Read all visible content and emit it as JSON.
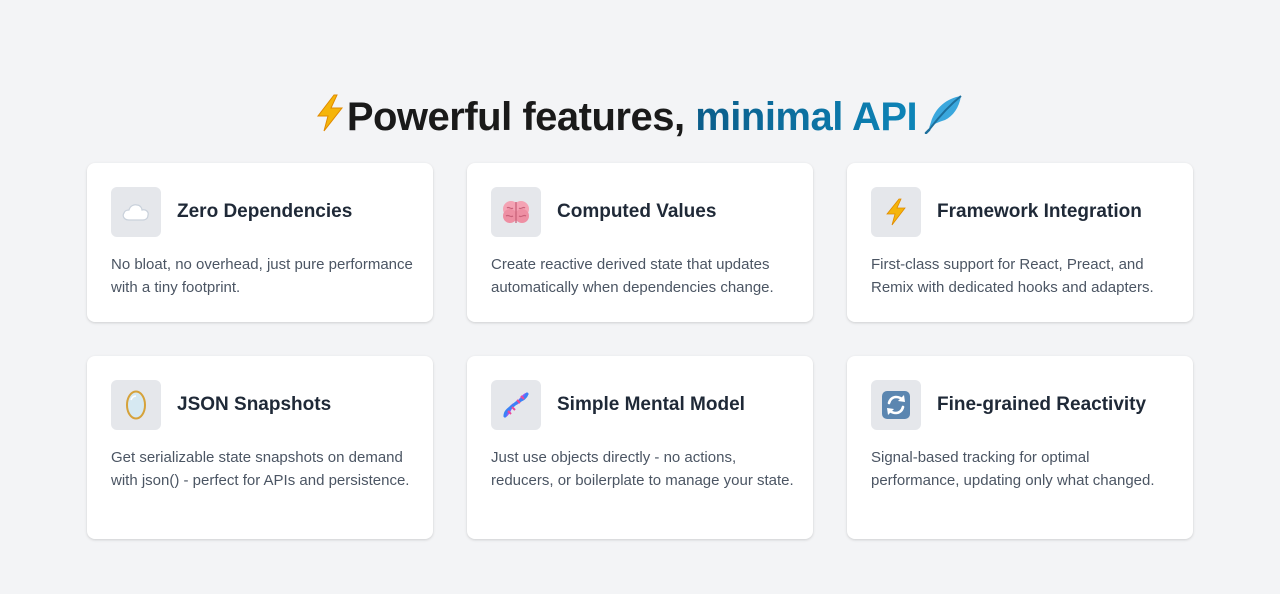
{
  "hero": {
    "title_plain": "Powerful features,",
    "title_accent": "minimal API",
    "leading_icon": "lightning-bolt",
    "trailing_icon": "feather",
    "accent_color": "#0b6f9f"
  },
  "features": [
    {
      "icon": "cloud",
      "title": "Zero Dependencies",
      "description": "No bloat, no overhead, just pure performance with a tiny footprint."
    },
    {
      "icon": "brain",
      "title": "Computed Values",
      "description": "Create reactive derived state that updates automatically when dependencies change."
    },
    {
      "icon": "lightning-bolt",
      "title": "Framework Integration",
      "description": "First-class support for React, Preact, and Remix with dedicated hooks and adapters."
    },
    {
      "icon": "mirror",
      "title": "JSON Snapshots",
      "description": "Get serializable state snapshots on demand with json() - perfect for APIs and persistence."
    },
    {
      "icon": "dna",
      "title": "Simple Mental Model",
      "description": "Just use objects directly - no actions, reducers, or boilerplate to manage your state."
    },
    {
      "icon": "refresh-arrows",
      "title": "Fine-grained Reactivity",
      "description": "Signal-based tracking for optimal performance, updating only what changed."
    }
  ]
}
